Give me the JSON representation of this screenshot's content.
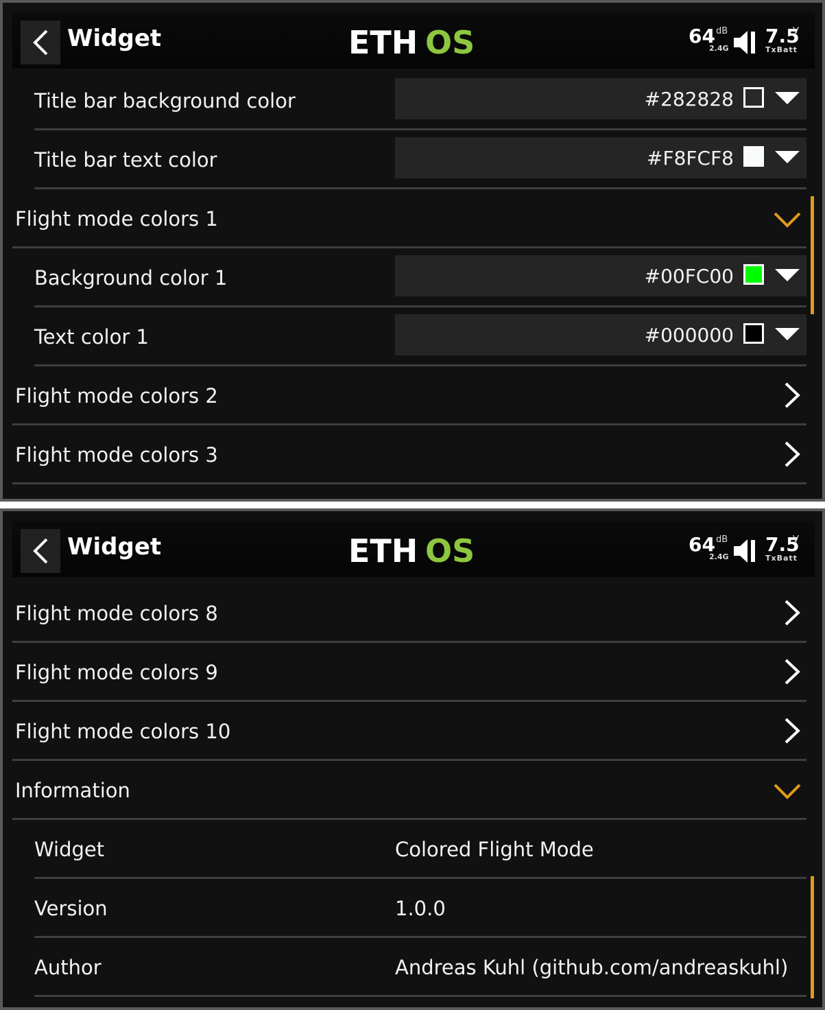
{
  "header": {
    "title": "Widget",
    "logo_left": "ETH",
    "logo_right": "OS",
    "rssi": "64",
    "rssi_unit": "dB",
    "band": "2.4G",
    "voltage": "7.5",
    "voltage_unit": "V",
    "battery_label": "TxBatt"
  },
  "screen1": {
    "rows": {
      "title_bg": {
        "label": "Title bar background color",
        "value": "#282828",
        "swatch": "#282828"
      },
      "title_text": {
        "label": "Title bar text color",
        "value": "#F8FCF8",
        "swatch": "#F8FCF8"
      },
      "fm1": {
        "label": "Flight mode colors 1"
      },
      "bg1": {
        "label": "Background color 1",
        "value": "#00FC00",
        "swatch": "#00FC00"
      },
      "text1": {
        "label": "Text color 1",
        "value": "#000000",
        "swatch": "#000000"
      },
      "fm2": {
        "label": "Flight mode colors 2"
      },
      "fm3": {
        "label": "Flight mode colors 3"
      }
    }
  },
  "screen2": {
    "rows": {
      "fm8": {
        "label": "Flight mode colors 8"
      },
      "fm9": {
        "label": "Flight mode colors 9"
      },
      "fm10": {
        "label": "Flight mode colors 10"
      },
      "info": {
        "label": "Information"
      },
      "widget": {
        "label": "Widget",
        "value": "Colored Flight Mode"
      },
      "version": {
        "label": "Version",
        "value": "1.0.0"
      },
      "author": {
        "label": "Author",
        "value": "Andreas Kuhl (github.com/andreaskuhl)"
      }
    }
  },
  "colors": {
    "accent": "#E09A1C",
    "logo_green": "#8DC63F",
    "background": "#111111"
  },
  "icons": {
    "back": "chevron-left-icon",
    "expanded": "chevron-down-icon",
    "collapsed": "chevron-right-icon",
    "dropdown": "triangle-down-icon",
    "volume": "speaker-icon"
  }
}
